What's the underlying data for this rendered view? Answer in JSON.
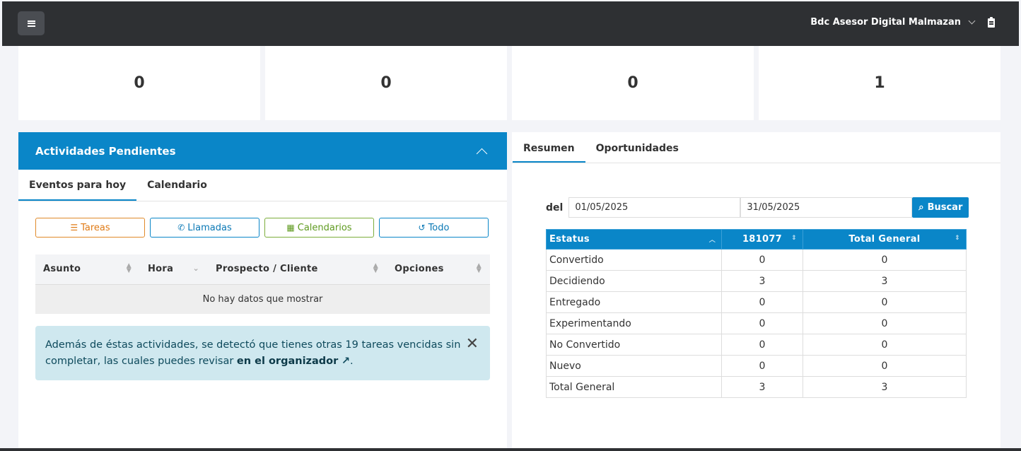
{
  "header": {
    "user_name": "Bdc Asesor Digital Malmazan"
  },
  "stats": [
    "0",
    "0",
    "0",
    "1"
  ],
  "activities": {
    "title": "Actividades Pendientes",
    "tabs": [
      "Eventos para hoy",
      "Calendario"
    ],
    "filters": [
      {
        "label": "Tareas",
        "icon": "tasks-icon"
      },
      {
        "label": "Llamadas",
        "icon": "phone-icon"
      },
      {
        "label": "Calendarios",
        "icon": "calendar-icon"
      },
      {
        "label": "Todo",
        "icon": "history-icon"
      }
    ],
    "columns": [
      "Asunto",
      "Hora",
      "Prospecto / Cliente",
      "Opciones"
    ],
    "empty_message": "No hay datos que mostrar",
    "alert_text": "Además de éstas actividades, se detectó que tienes otras 19 tareas vencidas sin completar, las cuales puedes revisar ",
    "alert_link": "en el organizador",
    "alert_end": "."
  },
  "summary": {
    "tabs": [
      "Resumen",
      "Oportunidades"
    ],
    "date_label": "del",
    "date_from": "01/05/2025",
    "date_to": "31/05/2025",
    "search_label": "Buscar",
    "columns": [
      "Estatus",
      "181077",
      "Total General"
    ],
    "rows": [
      [
        "Convertido",
        "0",
        "0"
      ],
      [
        "Decidiendo",
        "3",
        "3"
      ],
      [
        "Entregado",
        "0",
        "0"
      ],
      [
        "Experimentando",
        "0",
        "0"
      ],
      [
        "No Convertido",
        "0",
        "0"
      ],
      [
        "Nuevo",
        "0",
        "0"
      ],
      [
        "Total General",
        "3",
        "3"
      ]
    ]
  },
  "colors": {
    "primary": "#0a86c8",
    "topbar": "#2e3033",
    "alert_bg": "#cfe8ef"
  }
}
